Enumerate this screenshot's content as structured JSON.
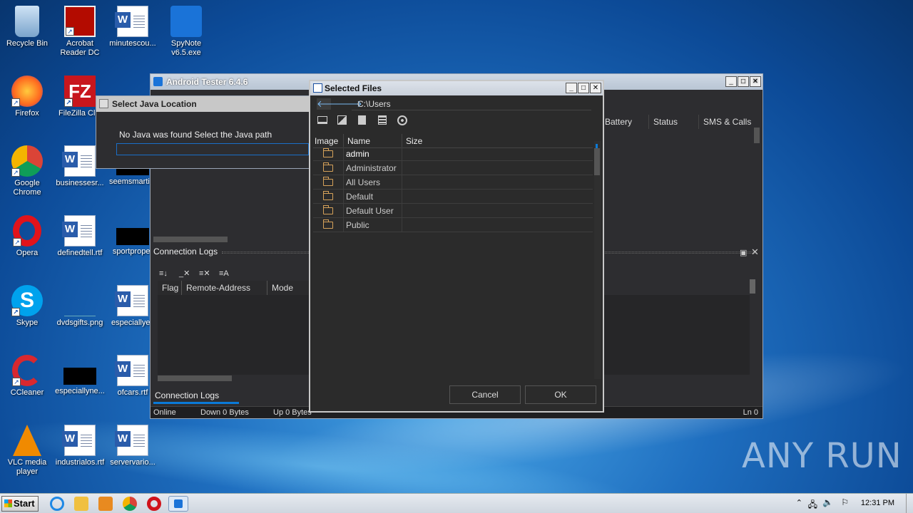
{
  "desktop": {
    "icons": [
      {
        "label": "Recycle Bin"
      },
      {
        "label": "Acrobat Reader DC"
      },
      {
        "label": "minutescou..."
      },
      {
        "label": "SpyNote v6.5.exe"
      },
      {
        "label": "Firefox"
      },
      {
        "label": "FileZilla Clie"
      },
      {
        "label": "Google Chrome"
      },
      {
        "label": "businessesr..."
      },
      {
        "label": "seemsmarti..."
      },
      {
        "label": "Opera"
      },
      {
        "label": "definedtell.rtf"
      },
      {
        "label": "sportproper"
      },
      {
        "label": "Skype"
      },
      {
        "label": "dvdsgifts.png"
      },
      {
        "label": "especiallyes"
      },
      {
        "label": "CCleaner"
      },
      {
        "label": "especiallyne..."
      },
      {
        "label": "ofcars.rtf"
      },
      {
        "label": "VLC media player"
      },
      {
        "label": "industrialos.rtf"
      },
      {
        "label": "servervario..."
      }
    ]
  },
  "main_window": {
    "title": "Android Tester 6.4.6",
    "columns": [
      "Battery",
      "Status",
      "SMS & Calls"
    ],
    "connection_panel_title": "Connection Logs",
    "log_columns": [
      "Flag",
      "Remote-Address",
      "Mode"
    ],
    "bottom_tab": "Connection Logs",
    "status": {
      "online": "Online",
      "down": "Down 0 Bytes",
      "up": "Up 0 Bytes",
      "ln": "Ln 0"
    }
  },
  "java_dialog": {
    "title": "Select Java Location",
    "message": "No Java was found Select the Java path"
  },
  "files_dialog": {
    "title": "Selected Files",
    "path": "C:\\Users",
    "columns": {
      "image": "Image",
      "name": "Name",
      "size": "Size"
    },
    "rows": [
      "admin",
      "Administrator",
      "All Users",
      "Default",
      "Default User",
      "Public"
    ],
    "cancel": "Cancel",
    "ok": "OK"
  },
  "taskbar": {
    "start": "Start",
    "clock": "12:31 PM"
  },
  "watermark": "ANY RUN"
}
